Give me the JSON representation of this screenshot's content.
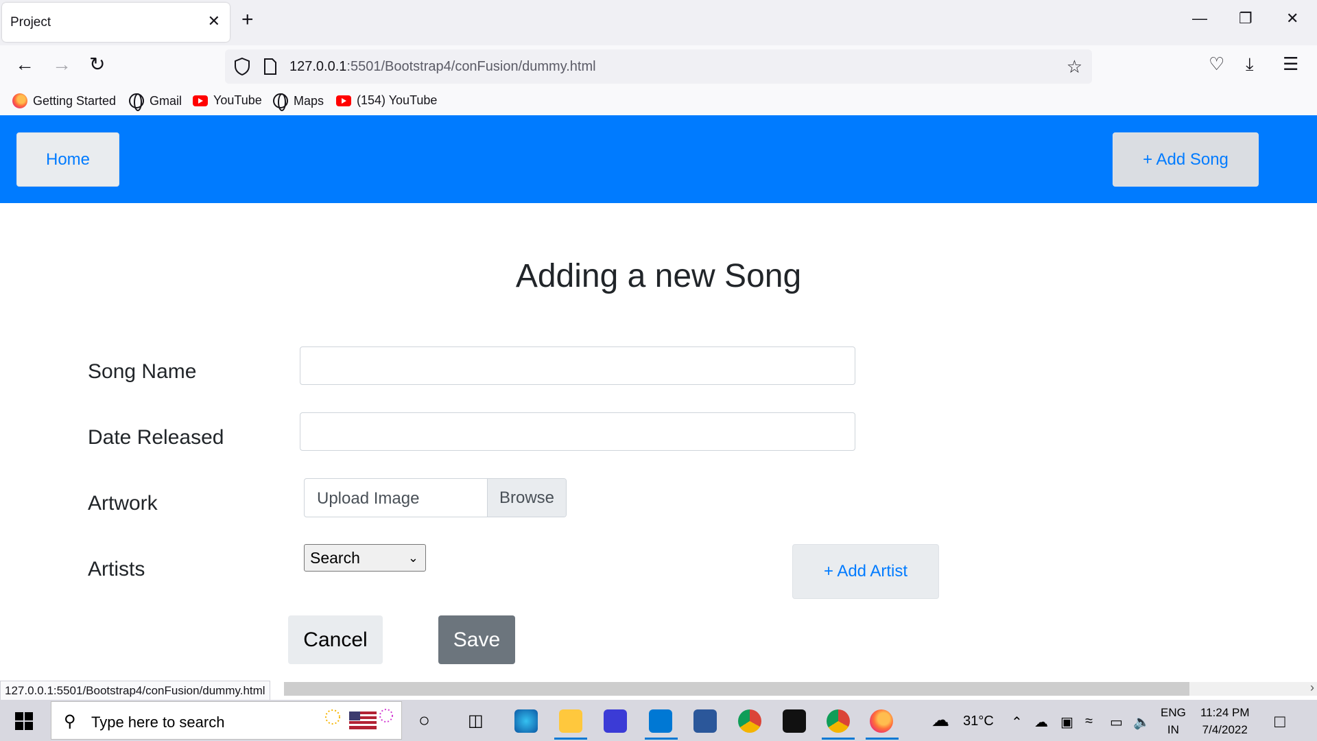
{
  "browser": {
    "tab_title": "Project",
    "tab_close": "✕",
    "new_tab": "+",
    "url_host": "127.0.0.1",
    "url_rest": ":5501/Bootstrap4/conFusion/dummy.html",
    "bookmarks": [
      "Getting Started",
      "Gmail",
      "YouTube",
      "Maps",
      "(154) YouTube"
    ],
    "status_url": "127.0.0.1:5501/Bootstrap4/conFusion/dummy.html"
  },
  "nav": {
    "home_label": "Home",
    "add_song_label": "+ Add Song"
  },
  "page": {
    "title": "Adding a new Song"
  },
  "form": {
    "song_name_label": "Song Name",
    "song_name_value": "",
    "date_label": "Date Released",
    "date_value": "",
    "artwork_label": "Artwork",
    "upload_label": "Upload Image",
    "browse_label": "Browse",
    "artists_label": "Artists",
    "artists_select_value": "Search",
    "add_artist_label": "+ Add Artist",
    "cancel_label": "Cancel",
    "save_label": "Save"
  },
  "taskbar": {
    "search_placeholder": "Type here to search",
    "temperature": "31°C",
    "lang_line1": "ENG",
    "lang_line2": "IN",
    "time": "11:24 PM",
    "date": "7/4/2022"
  },
  "colors": {
    "navbar": "#007bff",
    "save_button": "#6c757d",
    "link": "#007bff"
  }
}
